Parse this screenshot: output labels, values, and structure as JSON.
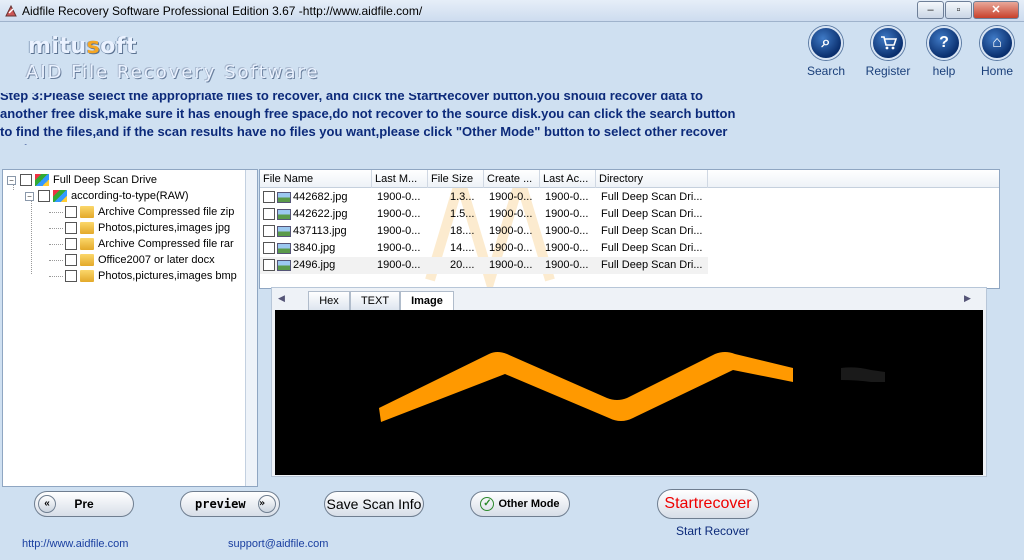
{
  "window": {
    "title": "Aidfile Recovery Software Professional Edition 3.67 -http://www.aidfile.com/",
    "controls": {
      "minimize": "–",
      "maximize": "▫",
      "close": "✕"
    }
  },
  "header": {
    "brand_prefix": "mitu",
    "brand_accent": "s",
    "brand_suffix": "oft",
    "subtitle": "AID File Recovery Software"
  },
  "topnav": [
    {
      "label": "Search",
      "icon": "search-icon",
      "glyph": "⌕"
    },
    {
      "label": "Register",
      "icon": "cart-icon",
      "glyph": "🛒"
    },
    {
      "label": "help",
      "icon": "help-icon",
      "glyph": "?"
    },
    {
      "label": "Home",
      "icon": "home-icon",
      "glyph": "⌂"
    }
  ],
  "instructions": "Step 3:Please select the appropriate files to recover, and click the StartRecover button.you should recover data to another free disk,make sure it has enough free space,do not recover to the source disk.you can click the search button to find the files,and if the scan results have no files you want,please click \"Other Mode\" button to select other recover mode",
  "tree": {
    "root": "Full Deep Scan Drive",
    "group": "according-to-type(RAW)",
    "items": [
      "Archive Compressed file zip",
      "Photos,pictures,images jpg",
      "Archive Compressed file rar",
      "Office2007 or later docx",
      "Photos,pictures,images bmp"
    ]
  },
  "table": {
    "columns": [
      "File Name",
      "Last M...",
      "File Size",
      "Create ...",
      "Last Ac...",
      "Directory"
    ],
    "rows": [
      [
        "442682.jpg",
        "1900-0...",
        "1.3...",
        "1900-0...",
        "1900-0...",
        "Full Deep Scan Dri..."
      ],
      [
        "442622.jpg",
        "1900-0...",
        "1.5...",
        "1900-0...",
        "1900-0...",
        "Full Deep Scan Dri..."
      ],
      [
        "437113.jpg",
        "1900-0...",
        "18....",
        "1900-0...",
        "1900-0...",
        "Full Deep Scan Dri..."
      ],
      [
        "3840.jpg",
        "1900-0...",
        "14....",
        "1900-0...",
        "1900-0...",
        "Full Deep Scan Dri..."
      ],
      [
        "2496.jpg",
        "1900-0...",
        "20....",
        "1900-0...",
        "1900-0...",
        "Full Deep Scan Dri..."
      ]
    ]
  },
  "preview": {
    "tabs": [
      "Hex",
      "TEXT",
      "Image"
    ],
    "active_tab": "Image"
  },
  "buttons": {
    "pre": "Pre",
    "pre_chevron": "«",
    "preview": "preview",
    "preview_chevron": "»",
    "save_scan": "Save Scan Info",
    "other_mode": "Other Mode",
    "other_mode_check": "✓",
    "start": "Startrecover",
    "start_label": "Start Recover"
  },
  "footer": {
    "website": "http://www.aidfile.com",
    "email": "support@aidfile.com"
  },
  "colors": {
    "background": "#cfe0f1",
    "instruction_text": "#0c2a7a",
    "start_text": "#ee0000",
    "image_stroke": "#ff9900"
  }
}
